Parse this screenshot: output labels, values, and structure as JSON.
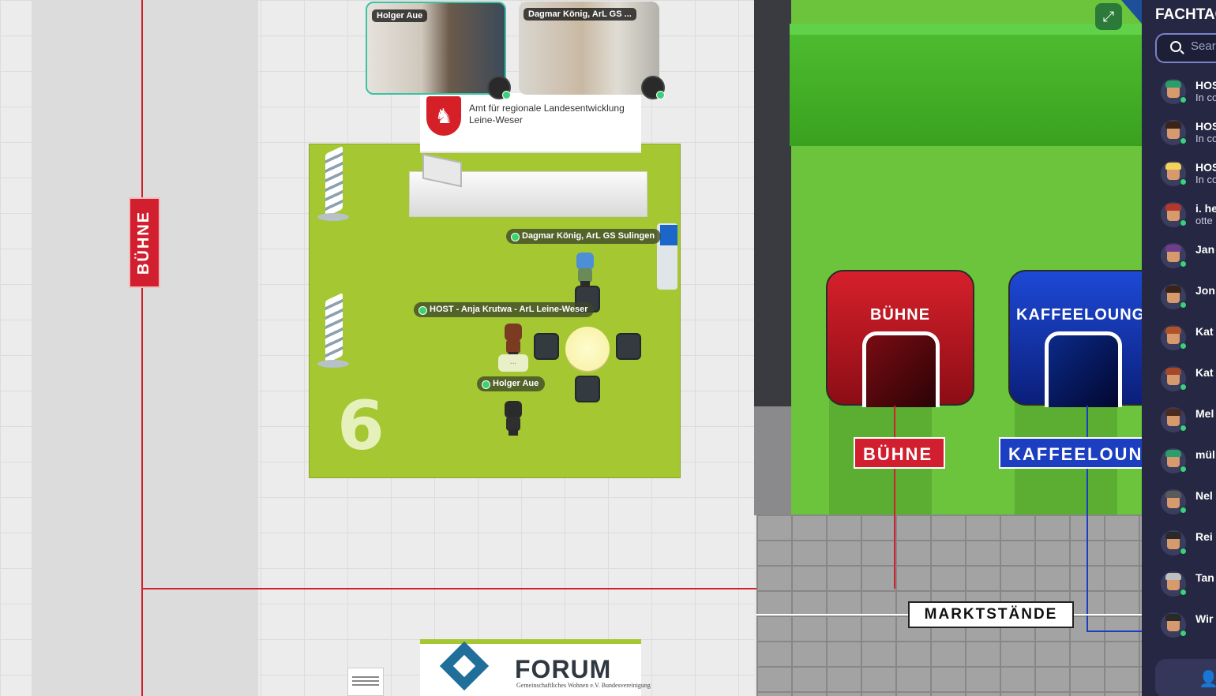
{
  "map": {
    "vertical_label": "BÜHNE",
    "booth_number": "6",
    "booth_sign": "Amt für regionale Landesentwicklung Leine-Weser",
    "name_tags": {
      "dagmar": "Dagmar König, ArL GS Sulingen",
      "anja": "HOST - Anja Krutwa - ArL Leine-Weser",
      "holger": "Holger Aue"
    },
    "bubble_text": "...",
    "forum_sign": {
      "title": "FORUM",
      "subtitle": "Gemeinschaftliches Wohnen e.V. Bundesvereinigung"
    }
  },
  "videos": [
    {
      "name": "Holger Aue",
      "active": true
    },
    {
      "name": "Dagmar König, ArL GS ...",
      "active": false
    }
  ],
  "portals": [
    {
      "title": "BÜHNE",
      "plate": "BÜHNE",
      "color": "#c0131f"
    },
    {
      "title": "KAFFEELOUNG",
      "plate": "KAFFEELOUN",
      "color": "#1b3fc0"
    }
  ],
  "marktstaende_label": "MARKTSTÄNDE",
  "expand_icon": "expand-icon",
  "sidebar": {
    "title": "FACHTAG",
    "search_placeholder": "Search",
    "participants": [
      {
        "name": "HOS",
        "status": "In co",
        "hair": "#2a9d6b"
      },
      {
        "name": "HOS",
        "status": "In co",
        "hair": "#3a2418"
      },
      {
        "name": "HOS",
        "status": "In co",
        "hair": "#f2d25a"
      },
      {
        "name": "i. he",
        "status": "otte",
        "hair": "#b4372d"
      },
      {
        "name": "Jan",
        "status": "",
        "hair": "#6e3d8e"
      },
      {
        "name": "Jon",
        "status": "",
        "hair": "#3a2418"
      },
      {
        "name": "Kat",
        "status": "",
        "hair": "#b1532a"
      },
      {
        "name": "Kat",
        "status": "",
        "hair": "#a5482a"
      },
      {
        "name": "Mel",
        "status": "",
        "hair": "#4a2b1d"
      },
      {
        "name": "mül",
        "status": "",
        "hair": "#2a9d6b"
      },
      {
        "name": "Nel",
        "status": "",
        "hair": "#5a5a5a"
      },
      {
        "name": "Rei",
        "status": "",
        "hair": "#2a2a2a"
      },
      {
        "name": "Tan",
        "status": "",
        "hair": "#bfbfbf"
      },
      {
        "name": "Wir",
        "status": "",
        "hair": "#2a2a2a"
      }
    ]
  }
}
